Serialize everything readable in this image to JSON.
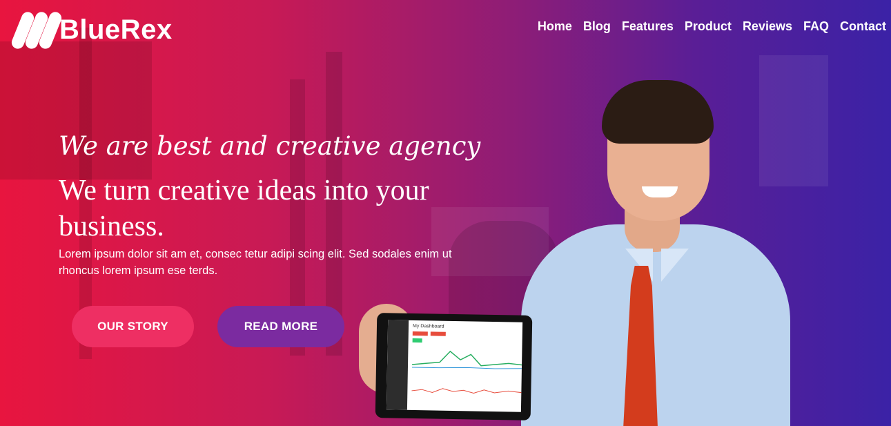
{
  "brand": {
    "name": "BlueRex",
    "logo_icon": "bluerex-logo-icon"
  },
  "nav": {
    "items": [
      "Home",
      "Blog",
      "Features",
      "Product",
      "Reviews",
      "FAQ",
      "Contact"
    ]
  },
  "hero": {
    "tagline": "We are best and creative agency",
    "headline": "We turn creative ideas into your business.",
    "lead": "Lorem ipsum dolor sit am et, consec tetur adipi scing elit. Sed sodales enim ut rhoncus lorem ipsum ese terds."
  },
  "buttons": {
    "story": "OUR STORY",
    "more": "READ MORE"
  },
  "tablet": {
    "title": "My Dashboard"
  },
  "colors": {
    "gradient_start": "#e8153f",
    "gradient_end": "#3b22a6",
    "story_button": "#ee2f63",
    "more_button": "#7b2ba0"
  }
}
